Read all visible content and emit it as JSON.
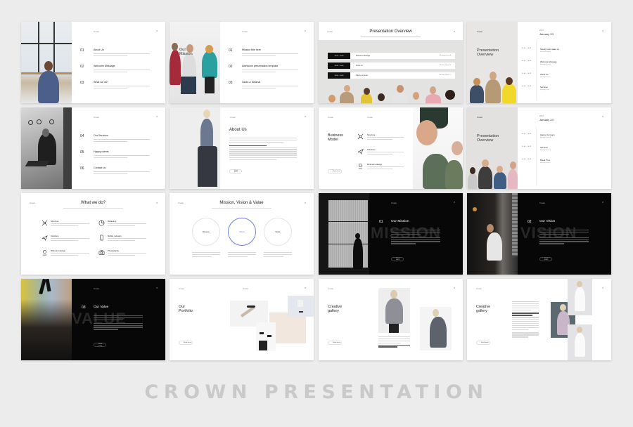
{
  "footer": {
    "title": "CROWN PRESENTATION"
  },
  "header_label": "Crown",
  "close_glyph": "×",
  "lorem": "Lorem ipsum dolor sit amet consectetur adipiscing elit",
  "slides": {
    "s1": {
      "items": [
        {
          "num": "01",
          "title": "About Us"
        },
        {
          "num": "02",
          "title": "Welcome Message"
        },
        {
          "num": "03",
          "title": "What we do?"
        }
      ]
    },
    "s2": {
      "side_title": "Our Mission",
      "items": [
        {
          "num": "01",
          "title": "Mission title here"
        },
        {
          "num": "02",
          "title": "Awesome presentation template"
        },
        {
          "num": "03",
          "title": "Clean & Minimal"
        }
      ]
    },
    "s3": {
      "title": "Presentation Overview",
      "rows": [
        {
          "time": "10:00 - 10:45",
          "label": "Welcome Message",
          "right": "Meeting Room A"
        },
        {
          "time": "10:00 - 10:45",
          "label": "About Us",
          "right": "Meeting Room B"
        },
        {
          "time": "10:00 - 10:45",
          "label": "Happy our team",
          "right": "Meeting Room C"
        }
      ]
    },
    "s4": {
      "side_title_1": "Presentation",
      "side_title_2": "Overview",
      "date_small": "2017",
      "date": "January 23",
      "items": [
        {
          "time": "10:00 - 10:45",
          "title": "Steady team wake up",
          "sub": "Meeting Room A"
        },
        {
          "time": "10:00 - 10:45",
          "title": "Welcome Message",
          "sub": "Meeting Room B"
        },
        {
          "time": "10:00 - 10:45",
          "title": "About Us",
          "sub": "Meeting Room C"
        },
        {
          "time": "10:00 - 10:45",
          "title": "Services",
          "sub": "Meeting Room"
        }
      ]
    },
    "s5": {
      "items": [
        {
          "num": "04",
          "title": "Our Services"
        },
        {
          "num": "05",
          "title": "Happy clients"
        },
        {
          "num": "06",
          "title": "Contact us"
        }
      ]
    },
    "s6": {
      "title": "About Us",
      "button": "Read more"
    },
    "s7": {
      "side_title_1": "Business",
      "side_title_2": "Model",
      "button": "Read more",
      "items": [
        {
          "icon": "structure-icon",
          "title": "Structure"
        },
        {
          "icon": "paper-plane-icon",
          "title": "Solutions"
        },
        {
          "icon": "location-pin-icon",
          "title": "Minimal redesign"
        }
      ]
    },
    "s8": {
      "side_title_1": "Presentation",
      "side_title_2": "Overview",
      "date_small": "2017",
      "date": "January 24",
      "items": [
        {
          "time": "10:00 - 10:45",
          "title": "Happy Our team",
          "sub": "Meeting Room A"
        },
        {
          "time": "10:00 - 10:45",
          "title": "Services",
          "sub": "Meeting Room B"
        },
        {
          "time": "10:00 - 10:45",
          "title": "Break Time",
          "sub": "Meeting Room C"
        }
      ]
    },
    "s9": {
      "title": "What we do?",
      "items": [
        {
          "icon": "structure-icon",
          "title": "Structure"
        },
        {
          "icon": "marketing-icon",
          "title": "Marketing"
        },
        {
          "icon": "paper-plane-icon",
          "title": "Solutions"
        },
        {
          "icon": "mobile-icon",
          "title": "Mobile redesign"
        },
        {
          "icon": "location-pin-icon",
          "title": "Minimal redesign"
        },
        {
          "icon": "camera-icon",
          "title": "Photography"
        }
      ]
    },
    "s10": {
      "title": "Mission, Vision & Value",
      "circles": [
        {
          "label": "Mission"
        },
        {
          "label": "Vision"
        },
        {
          "label": "Value"
        }
      ],
      "accent": "#6d7fe0"
    },
    "s11": {
      "num": "01",
      "title": "Our Mission",
      "ghost": "MISSION",
      "button": "Read more"
    },
    "s12": {
      "num": "02",
      "title": "Our Vision",
      "ghost": "VISION",
      "button": "Read more"
    },
    "s13": {
      "num": "03",
      "title": "Our Value",
      "ghost": "VALUE",
      "button": "Read more"
    },
    "s14": {
      "side_title_1": "Our",
      "side_title_2": "Portfolio",
      "button": "Read more"
    },
    "s15": {
      "side_title_1": "Creative",
      "side_title_2": "gallery",
      "button": "Read more"
    },
    "s16": {
      "side_title_1": "Creative",
      "side_title_2": "gallery",
      "button": "Read more"
    }
  }
}
